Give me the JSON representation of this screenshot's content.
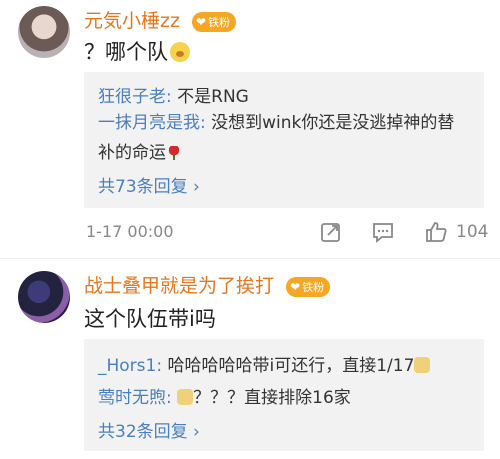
{
  "comments": [
    {
      "username": "元気小棰zz",
      "badge": "铁粉",
      "text": "？哪个队",
      "replies": [
        {
          "name": "狂很子老",
          "sep": ": ",
          "text": "不是RNG"
        },
        {
          "name": "一抹月亮是我",
          "sep": ": ",
          "text": "没想到wink你还是没逃掉神的替补的命运"
        }
      ],
      "more": "共73条回复 ›",
      "time": "1-17 00:00",
      "likes": "104"
    },
    {
      "username": "战士叠甲就是为了挨打",
      "badge": "铁粉",
      "text": "这个队伍带i吗",
      "replies": [
        {
          "name": "_Hors1",
          "sep": ": ",
          "text": "哈哈哈哈哈带i可还行，直接1/17"
        },
        {
          "name": "莺时无煦",
          "sep": ": ",
          "text": "？？？直接排除16家"
        }
      ],
      "more": "共32条回复 ›"
    }
  ],
  "icons": {
    "share": "share-icon",
    "comment": "comment-icon",
    "like": "thumbs-up-icon",
    "emoji": "emoji-icon",
    "rose": "rose-icon",
    "cat": "cat-emoji-icon"
  },
  "colors": {
    "username": "#e5771f",
    "reply_name": "#4a7fbf",
    "badge": "#f5a623",
    "reply_bg": "#f2f2f2"
  }
}
